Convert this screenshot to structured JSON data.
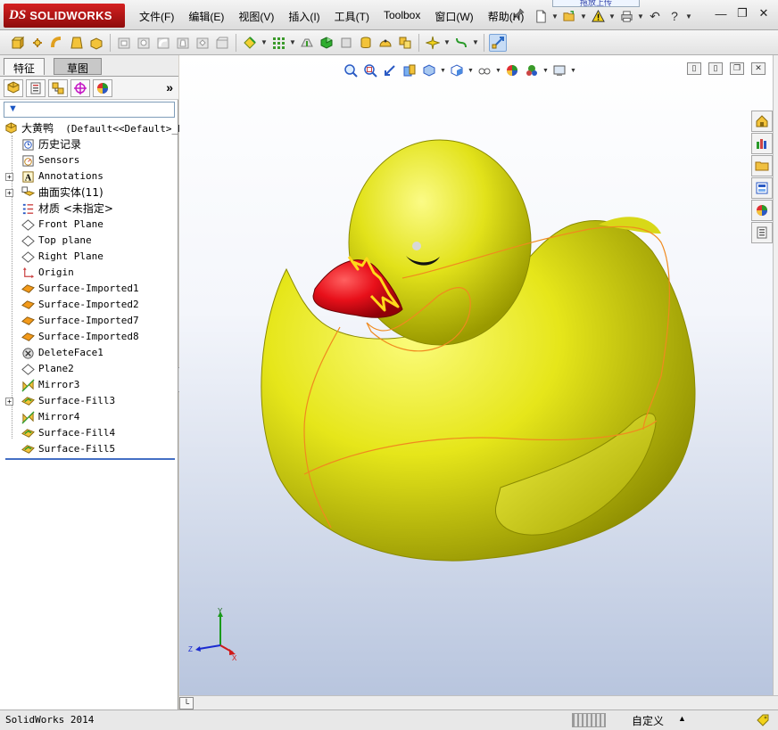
{
  "app": {
    "logo_prefix": "DS",
    "logo_name": "SOLIDWORKS",
    "floater_text": "拖放上传"
  },
  "menu": [
    {
      "label": "文件(F)"
    },
    {
      "label": "编辑(E)"
    },
    {
      "label": "视图(V)"
    },
    {
      "label": "插入(I)"
    },
    {
      "label": "工具(T)"
    },
    {
      "label": "Toolbox"
    },
    {
      "label": "窗口(W)"
    },
    {
      "label": "帮助(H)"
    }
  ],
  "panel": {
    "tabs": [
      {
        "label": "特征",
        "selected": true
      },
      {
        "label": "草图",
        "selected": false
      }
    ],
    "more_label": "»",
    "filter_icon": "▼"
  },
  "tree": {
    "root": {
      "label": "大黄鸭",
      "config": "(Default<<Default>_Ph"
    },
    "items": [
      {
        "label": "历史记录",
        "icon": "history-icon",
        "expand": false,
        "cjk": true
      },
      {
        "label": "Sensors",
        "icon": "sensors-icon",
        "expand": false,
        "cjk": false
      },
      {
        "label": "Annotations",
        "icon": "annotations-icon",
        "expand": true,
        "cjk": false
      },
      {
        "label": "曲面实体(11)",
        "icon": "surface-bodies-icon",
        "expand": true,
        "cjk": true
      },
      {
        "label": "材质 <未指定>",
        "icon": "material-icon",
        "expand": false,
        "cjk": true
      },
      {
        "label": "Front Plane",
        "icon": "plane-icon",
        "expand": false,
        "cjk": false
      },
      {
        "label": "Top plane",
        "icon": "plane-icon",
        "expand": false,
        "cjk": false
      },
      {
        "label": "Right Plane",
        "icon": "plane-icon",
        "expand": false,
        "cjk": false
      },
      {
        "label": "Origin",
        "icon": "origin-icon",
        "expand": false,
        "cjk": false
      },
      {
        "label": "Surface-Imported1",
        "icon": "surface-imported-icon",
        "expand": false,
        "cjk": false
      },
      {
        "label": "Surface-Imported2",
        "icon": "surface-imported-icon",
        "expand": false,
        "cjk": false
      },
      {
        "label": "Surface-Imported7",
        "icon": "surface-imported-icon",
        "expand": false,
        "cjk": false
      },
      {
        "label": "Surface-Imported8",
        "icon": "surface-imported-icon",
        "expand": false,
        "cjk": false
      },
      {
        "label": "DeleteFace1",
        "icon": "delete-face-icon",
        "expand": false,
        "cjk": false
      },
      {
        "label": "Plane2",
        "icon": "plane-icon",
        "expand": false,
        "cjk": false
      },
      {
        "label": "Mirror3",
        "icon": "mirror-icon",
        "expand": false,
        "cjk": false
      },
      {
        "label": "Surface-Fill3",
        "icon": "surface-fill-icon",
        "expand": true,
        "cjk": false
      },
      {
        "label": "Mirror4",
        "icon": "mirror-icon",
        "expand": false,
        "cjk": false
      },
      {
        "label": "Surface-Fill4",
        "icon": "surface-fill-icon",
        "expand": false,
        "cjk": false
      },
      {
        "label": "Surface-Fill5",
        "icon": "surface-fill-icon",
        "expand": false,
        "cjk": false
      }
    ]
  },
  "triad": {
    "x": "X",
    "y": "Y",
    "z": "Z"
  },
  "status": {
    "left": "SolidWorks 2014",
    "mode": "自定义",
    "up_arrow": "▲"
  },
  "colors": {
    "duck_body": "#e6e61a",
    "beak": "#e8101a",
    "edge_lines": "#f08a1e",
    "brand_red": "#c01818"
  }
}
